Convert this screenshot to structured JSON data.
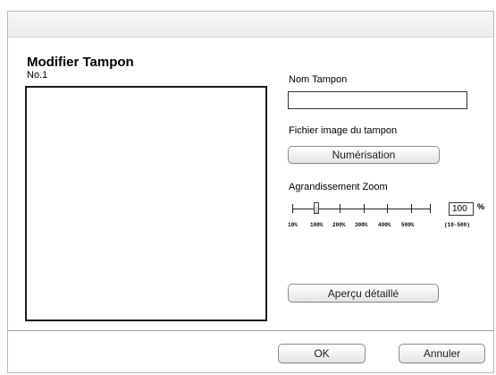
{
  "dialog": {
    "title": "Modifier Tampon",
    "stamp_number": "No.1"
  },
  "form": {
    "stamp_name_label": "Nom Tampon",
    "stamp_name_value": "",
    "image_file_label": "Fichier image du tampon",
    "scan_button": "Numérisation",
    "zoom_label": "Agrandissement Zoom",
    "zoom_ticks": [
      "10%",
      "100%",
      "200%",
      "300%",
      "400%",
      "500%"
    ],
    "zoom_value": "100",
    "zoom_unit": "%",
    "zoom_range": "(10-500)",
    "zoom_level_percent": 100,
    "preview_button": "Aperçu détaillé"
  },
  "footer": {
    "ok_button": "OK",
    "cancel_button": "Annuler"
  }
}
